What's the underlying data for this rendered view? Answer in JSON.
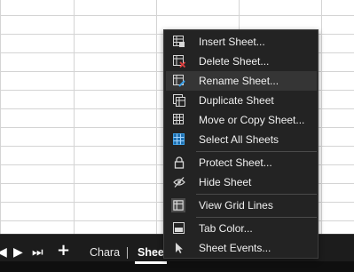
{
  "sheet_tabs": {
    "nav": [
      "◀",
      "▶",
      "⏭",
      "+"
    ],
    "tabs": [
      {
        "label": "Chara",
        "active": false
      },
      {
        "label": "Sheet",
        "active": true
      }
    ]
  },
  "context_menu": {
    "items": [
      {
        "label": "Insert Sheet...",
        "icon": "insert-sheet-icon"
      },
      {
        "label": "Delete Sheet...",
        "icon": "delete-sheet-icon"
      },
      {
        "label": "Rename Sheet...",
        "icon": "rename-sheet-icon",
        "highlighted": true
      },
      {
        "label": "Duplicate Sheet",
        "icon": "duplicate-sheet-icon"
      },
      {
        "label": "Move or Copy Sheet...",
        "icon": "move-copy-sheet-icon"
      },
      {
        "label": "Select All Sheets",
        "icon": "select-all-sheets-icon"
      },
      {
        "label": "Protect Sheet...",
        "icon": "lock-icon"
      },
      {
        "label": "Hide Sheet",
        "icon": "hide-eye-icon"
      },
      {
        "label": "View Grid Lines",
        "icon": "grid-lines-icon",
        "checked": true
      },
      {
        "label": "Tab Color...",
        "icon": "tab-color-icon"
      },
      {
        "label": "Sheet Events...",
        "icon": "sheet-events-icon"
      }
    ]
  },
  "colors": {
    "menu_bg": "#232323",
    "menu_hover": "#353535",
    "tabbar_bg": "#1c1c1c",
    "grid_line": "#d4d4d4",
    "delete_red": "#e04040",
    "select_blue": "#3aa0e8"
  }
}
